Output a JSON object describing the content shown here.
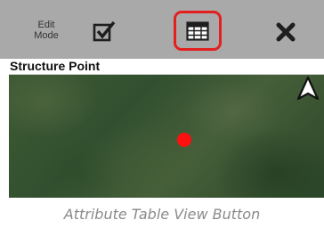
{
  "toolbar": {
    "edit_mode_line1": "Edit",
    "edit_mode_line2": "Mode",
    "highlight_color": "#e3201f"
  },
  "form": {
    "title": "Structure Point"
  },
  "map": {
    "point_color": "#ff1010"
  },
  "caption": "Attribute Table View Button",
  "icons": [
    "checkbox-check-icon",
    "table-icon",
    "close-icon",
    "navigation-arrow-icon"
  ]
}
